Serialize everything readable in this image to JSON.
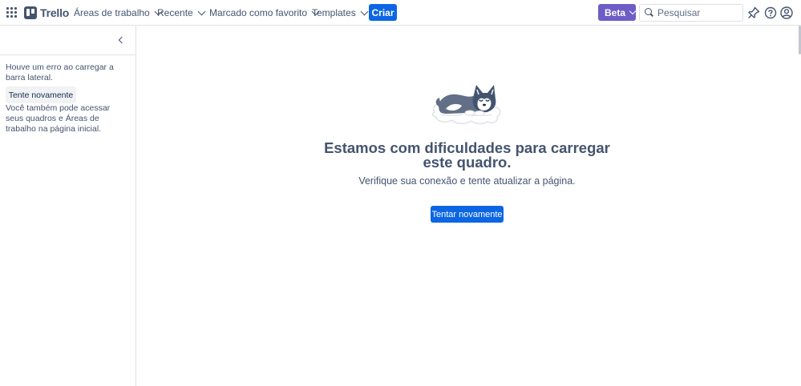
{
  "topbar": {
    "app_name": "Trello",
    "nav": [
      {
        "label": "Áreas de trabalho"
      },
      {
        "label": "Recente"
      },
      {
        "label": "Marcado como favorito"
      },
      {
        "label": "Templates"
      }
    ],
    "create_label": "Criar",
    "beta_label": "Beta",
    "search_placeholder": "Pesquisar",
    "icons": [
      "apps-grid-icon",
      "trello-logo-icon",
      "chevron-down-icon",
      "search-icon",
      "notifications-icon",
      "help-icon",
      "account-avatar-icon"
    ],
    "accent_color": "#0c66e4",
    "beta_color": "#6e5dc6"
  },
  "sidebar": {
    "error_message": "Houve um erro ao carregar a barra lateral.",
    "retry_label": "Tente novamente",
    "help_message": "Você também pode acessar seus quadros e Áreas de trabalho na página inicial.",
    "collapse_icon": "chevron-left-icon"
  },
  "main": {
    "title": "Estamos com dificuldades para carregar este quadro.",
    "subtitle": "Verifique sua conexão e tente atualizar a página.",
    "retry_label": "Tentar novamente",
    "illustration": "sleeping-husky-illustration"
  }
}
